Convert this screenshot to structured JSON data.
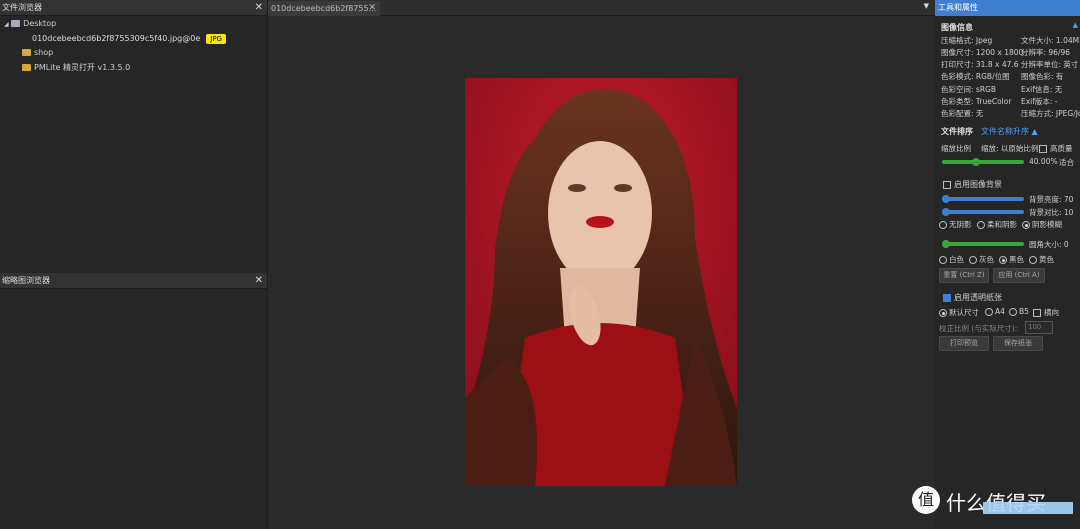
{
  "left_panel": {
    "title": "文件浏览器",
    "tree": {
      "root": "Desktop",
      "file": "010dcebeebcd6b2f8755309c5f40.jpg@0e",
      "badge": "JPG",
      "folder1": "shop",
      "folder2": "PMLite 精灵打开 v1.3.5.0"
    }
  },
  "bottom_left_panel": {
    "title": "缩略图浏览器"
  },
  "doc_tab": {
    "label": "010dcebeebcd6b2f8755..."
  },
  "right_panel": {
    "title": "工具和属性",
    "image_info_title": "图像信息",
    "info": [
      [
        "压缩格式: Jpeg",
        "文件大小: 1.04M"
      ],
      [
        "图像尺寸: 1200 x 1800",
        "分辨率: 96/96"
      ],
      [
        "打印尺寸: 31.8 x 47.6",
        "分辨率单位: 英寸"
      ],
      [
        "色彩模式: RGB/位图",
        "图像色彩: 有"
      ],
      [
        "色彩空间: sRGB",
        "Exif信息: 无"
      ],
      [
        "色彩类型: TrueColor",
        "Exif版本: -"
      ],
      [
        "色彩配置: 无",
        "压缩方式: JPEG/Jc"
      ]
    ],
    "sort_label": "文件排序",
    "sort_link": "文件名称升序 ▲",
    "zoom_label": "缩放比例",
    "fit_label": "缩放: 以原始比例",
    "zoom_pct": "40.00%",
    "fit_btn": "适合",
    "smooth_label": "高质量",
    "bg_check": "启用图像背景",
    "slider1_label": "背景亮度: 70",
    "slider2_label": "背景对比: 10",
    "radios1": [
      "无阴影",
      "柔和阴影",
      "阴影模糊"
    ],
    "slider3_label": "圆角大小: 0",
    "radios2": [
      "白色",
      "灰色",
      "黑色",
      "黄色"
    ],
    "btn_reset": "重置 (Ctrl Z)",
    "btn_apply": "应用 (Ctrl A)",
    "print_check": "启用透明纸张",
    "radios3": [
      "默认尺寸",
      "A4",
      "B5"
    ],
    "orientation": "横向",
    "custom_label": "校正比例 (与实际尺寸):",
    "custom_value": "100",
    "btn_print": "打印预览",
    "btn_save": "保存纸张"
  },
  "watermark": {
    "text": "值 什么值得买"
  },
  "colors": {
    "accent": "#3f7fd1",
    "slider_green": "#3aa63a",
    "slider_blue": "#3f7fd1",
    "badge": "#ffe600"
  }
}
